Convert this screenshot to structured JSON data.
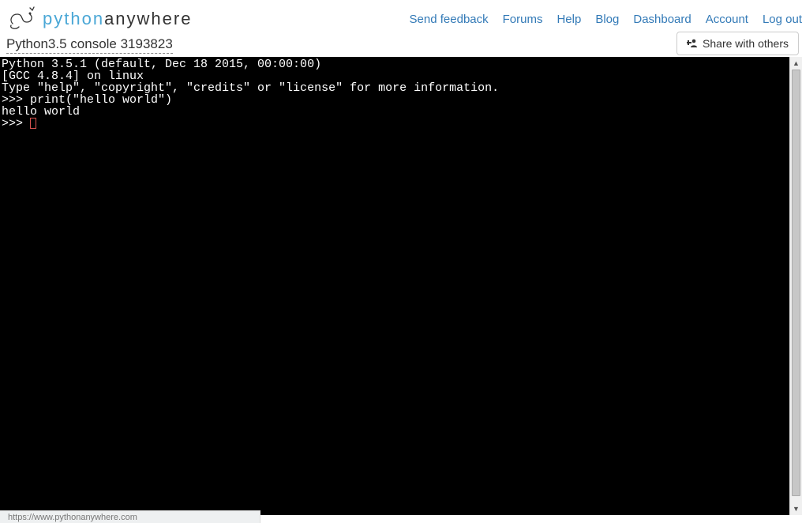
{
  "brand": {
    "py": "python",
    "rest": "anywhere"
  },
  "nav": {
    "feedback": "Send feedback",
    "forums": "Forums",
    "help": "Help",
    "blog": "Blog",
    "dashboard": "Dashboard",
    "account": "Account",
    "logout": "Log out"
  },
  "console_title": "Python3.5 console 3193823",
  "share_label": "Share with others",
  "terminal": {
    "l1": "Python 3.5.1 (default, Dec 18 2015, 00:00:00)",
    "l2": "[GCC 4.8.4] on linux",
    "l3": "Type \"help\", \"copyright\", \"credits\" or \"license\" for more information.",
    "l4": ">>> print(\"hello world\")",
    "l5": "hello world",
    "l6": ">>> "
  },
  "status_url": "https://www.pythonanywhere.com"
}
